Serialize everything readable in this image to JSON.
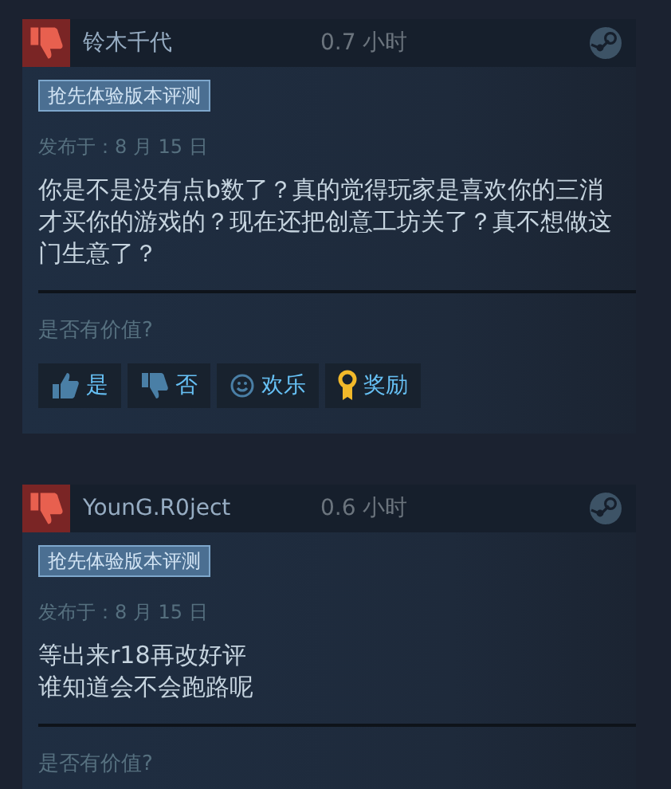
{
  "reviews": [
    {
      "recommended": false,
      "author": "铃木千代",
      "hours": "0.7 小时",
      "tag": "抢先体验版本评测",
      "posted": "发布于：8 月 15 日",
      "body": [
        "你是不是没有点b数了？真的觉得玩家是喜欢你的三消才买你的游戏的？现在还把创意工坊关了？真不想做这门生意了？"
      ],
      "helpful_prompt": "是否有价值?",
      "actions": [
        {
          "kind": "thumbs_up",
          "label": "是"
        },
        {
          "kind": "thumbs_down",
          "label": "否"
        },
        {
          "kind": "smile",
          "label": "欢乐"
        },
        {
          "kind": "award",
          "label": "奖励"
        }
      ]
    },
    {
      "recommended": false,
      "author": "YounG.R0ject",
      "hours": "0.6 小时",
      "tag": "抢先体验版本评测",
      "posted": "发布于：8 月 15 日",
      "body": [
        "等出来r18再改好评",
        "谁知道会不会跑路呢"
      ],
      "helpful_prompt": "是否有价值?"
    }
  ]
}
